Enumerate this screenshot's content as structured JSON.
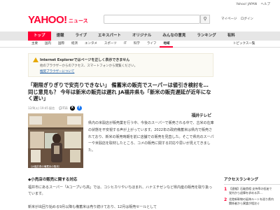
{
  "topbar": {
    "links": [
      "Yahoo! JAPAN",
      "ヘルプ"
    ]
  },
  "header": {
    "logo": "YAHOO!",
    "logo_sub": "ニュース",
    "search_placeholder": "",
    "search_icon": "search-icon",
    "user_links": [
      "マイページ",
      "ログイン"
    ]
  },
  "mainnav": {
    "tabs": [
      "トップ",
      "速報",
      "ライブ",
      "エキスパート",
      "オリジナル",
      "みんなの意見",
      "ランキング",
      "有料"
    ],
    "active": 0
  },
  "subnav": {
    "items": [
      "主要",
      "国内",
      "国際",
      "経済",
      "エンタメ",
      "スポーツ",
      "IT",
      "科学",
      "ライフ",
      "地域"
    ],
    "active": 9,
    "right": "トピックス一覧"
  },
  "warning": {
    "title": "Internet Explorerではページを正しく表示できません",
    "text": "他のブラウザーからのアクセス、スマートフォンから閲覧ください。",
    "link": "推奨ブラウザーについて"
  },
  "article": {
    "headline": "「期限ぎりぎりで安売りできない」 備蓄米の販売でスーパーは値引き検討を… 同じ意見も？ 今年は新米の販売は遅れ JA福井県も「新米の販売遅延が近年になく遅い」",
    "date": "12/9(火) 19:45 配信",
    "comment_count": "711",
    "share_x": "X",
    "share_fb": "f",
    "source": "福井テレビ",
    "photo_caption": "（JA福井県の備蓄米の販売）",
    "body": "県内の米穀店が販売業を行う中、今後のスーパーで販売される中で、古米の在庫の状態を不安視する声が上がっています。2022年の政府備蓄米は県内で販売されており、新米の販売時期を前に店舗での販売を見直した。そこで県内のスーパーや米穀店を取材したところ、コメの販売に関する対応や思いが見えてきました。",
    "section_head": "◆小売店の販売に関する対応",
    "para2": "福井市にあるスーパー「Aコープいち高」では、コシヒカリやいちほまれ、ハナエチゼンなど県内産の販売を取り扱っています。",
    "para3": "新米が出回り始める9月以降も備蓄米は売り続けており、12月は販売セールとして"
  },
  "sidebar": {
    "title": "アクセスランキング",
    "items": [
      {
        "num": "1",
        "text": "【速報】石破首相 支持率の低迷で党内から退陣を求める声…"
      },
      {
        "num": "2",
        "text": "北陸新幹線の延伸ルートを巡り県内関係者から異論が相次ぐ"
      }
    ]
  },
  "colors": {
    "brand": "#ff0033",
    "nav_bg": "#e6e6e6",
    "warning_bg": "#fbfaf4",
    "link": "#1a5aa3"
  }
}
